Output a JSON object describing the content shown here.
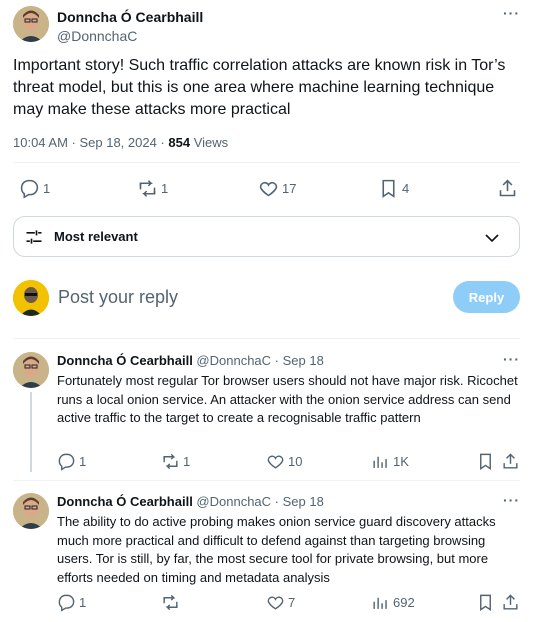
{
  "main_tweet": {
    "author_name": "Donncha Ó Cearbhaill",
    "author_handle": "@DonnchaC",
    "more_label": "···",
    "text": "Important story! Such traffic correlation attacks are known risk in Tor’s threat model, but this is one area where machine learning technique may make these attacks more practical",
    "time": "10:04 AM · Sep 18, 2024 · ",
    "views_count": "854",
    "views_label": " Views",
    "actions": {
      "replies": "1",
      "reposts": "1",
      "likes": "17",
      "bookmarks": "4"
    }
  },
  "sort": {
    "label": "Most relevant"
  },
  "composer": {
    "placeholder": "Post your reply",
    "button_label": "Reply"
  },
  "replies": [
    {
      "author_name": "Donncha Ó Cearbhaill",
      "author_meta": " @DonnchaC · Sep 18",
      "more_label": "···",
      "text": "Fortunately most regular Tor browser users should not have major risk. Ricochet runs a local onion service. An attacker with the onion service address can send active traffic to the target to create a recognisable traffic pattern",
      "replies": "1",
      "reposts": "1",
      "likes": "10",
      "views": "1K"
    },
    {
      "author_name": "Donncha Ó Cearbhaill",
      "author_meta": " @DonnchaC · Sep 18",
      "more_label": "···",
      "text": "The ability to do active probing makes onion service guard discovery attacks much more practical and difficult to defend against than targeting browsing users. Tor is still, by far, the most secure tool for private browsing, but more efforts needed on timing and metadata analysis",
      "replies": "1",
      "reposts": "",
      "likes": "7",
      "views": "692"
    }
  ],
  "colors": {
    "secondary_text": "#536471",
    "reply_button": "#8ecdf8",
    "divider": "#eff3f4"
  }
}
